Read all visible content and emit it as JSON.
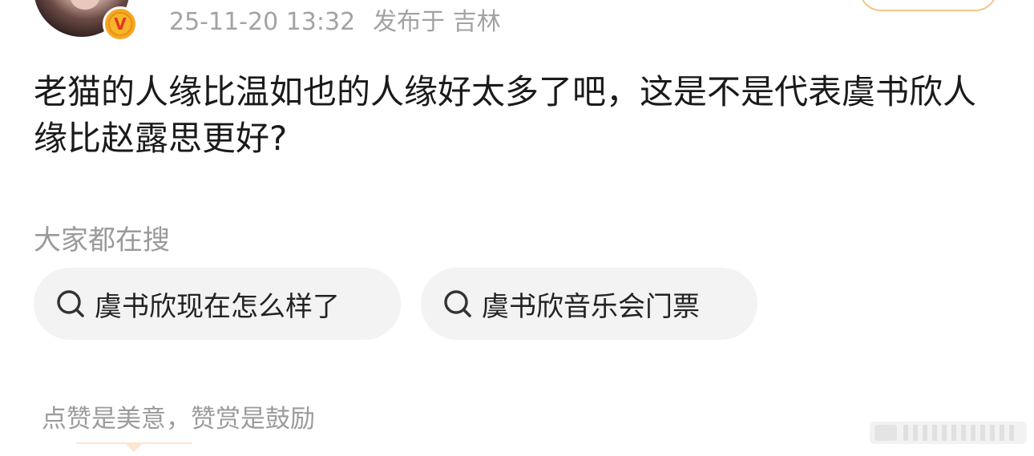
{
  "post": {
    "timestamp": "25-11-20 13:32",
    "location": "发布于 吉林",
    "content": "老猫的人缘比温如也的人缘好太多了吧，这是不是代表虞书欣人缘比赵露思更好?"
  },
  "trending": {
    "heading": "大家都在搜",
    "items": [
      {
        "label": "虞书欣现在怎么样了"
      },
      {
        "label": "虞书欣音乐会门票"
      }
    ]
  },
  "reward": {
    "text": "点赞是美意，赞赏是鼓励"
  },
  "badge": {
    "letter": "V",
    "color": "#f5a623"
  },
  "colors": {
    "meta_text": "#a3a3a3",
    "chip_bg": "#f3f3f3",
    "follow_border": "#f2c58a"
  }
}
